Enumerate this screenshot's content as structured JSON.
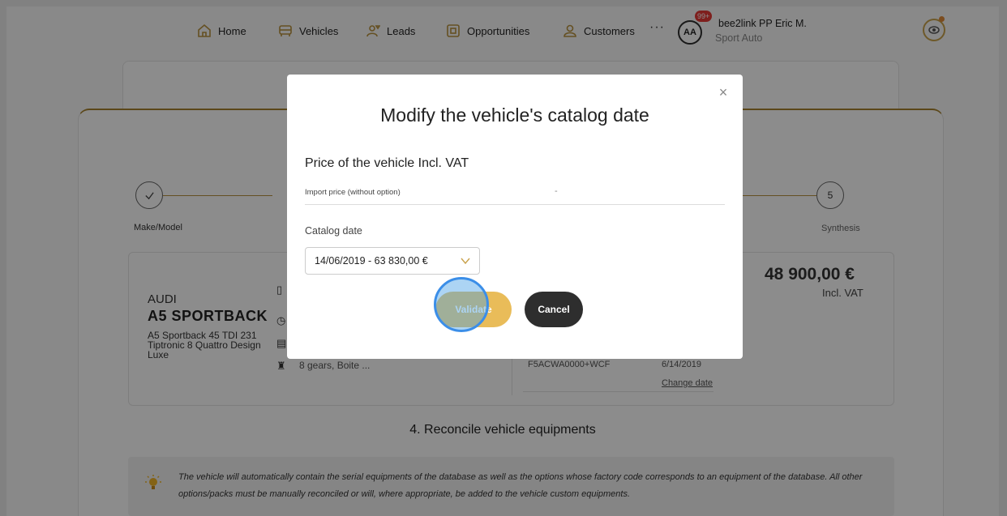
{
  "nav": {
    "items": [
      {
        "label": "Home",
        "icon": "home-icon"
      },
      {
        "label": "Vehicles",
        "icon": "car-icon"
      },
      {
        "label": "Leads",
        "icon": "leads-icon"
      },
      {
        "label": "Opportunities",
        "icon": "opportunities-icon"
      },
      {
        "label": "Customers",
        "icon": "customers-icon"
      }
    ],
    "more": "···",
    "avatar_initials": "AA",
    "notification_count": "99+",
    "user_name": "bee2link PP Eric M.",
    "company": "Sport Auto",
    "accent_color": "#b8923f"
  },
  "stepper": {
    "first_step_label": "Make/Model",
    "last_step_number": "5",
    "last_step_label": "Synthesis"
  },
  "vehicle": {
    "make": "AUDI",
    "model": "A5 SPORTBACK",
    "version": "A5 Sportback 45 TDI 231 Tiptronic 8 Quattro Design Luxe",
    "gearbox": "8 gears, Boite ...",
    "price": "48 900,00 €",
    "price_vat": "Incl. VAT",
    "code": "F5ACWA0000+WCF",
    "catalog_date": "6/14/2019",
    "change_date_link": "Change date"
  },
  "section": {
    "title": "4. Reconcile vehicle equipments",
    "info": "The vehicle will automatically contain the serial equipments of the database as well as the options whose factory code corresponds to an equipment of the database. All other options/packs must be manually reconciled or will, where appropriate, be added to the vehicle custom equipments."
  },
  "modal": {
    "title": "Modify the vehicle's catalog date",
    "close_symbol": "×",
    "price_heading": "Price of the vehicle Incl. VAT",
    "import_label": "Import price (without option)",
    "import_value": "-",
    "catalog_label": "Catalog date",
    "catalog_selected": "14/06/2019 - 63 830,00 €",
    "validate_label": "Validate",
    "cancel_label": "Cancel",
    "validate_color": "#e9bc59",
    "cancel_color": "#2e2e2e"
  }
}
